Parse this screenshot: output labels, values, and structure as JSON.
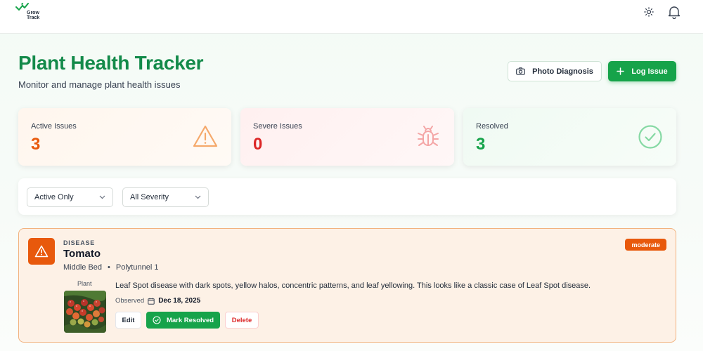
{
  "brand": {
    "logo_text_1": "Grow",
    "logo_text_2": "Track"
  },
  "header": {
    "theme_icon": "sun-icon",
    "notifications_icon": "bell-icon"
  },
  "page": {
    "title": "Plant Health Tracker",
    "subtitle": "Monitor and manage plant health issues",
    "photo_button": "Photo Diagnosis",
    "log_button": "Log Issue"
  },
  "stats": [
    {
      "label": "Active Issues",
      "value": "3",
      "icon": "warning-triangle-icon",
      "color": "#e8590c"
    },
    {
      "label": "Severe Issues",
      "value": "0",
      "icon": "bug-icon",
      "color": "#dc2626"
    },
    {
      "label": "Resolved",
      "value": "3",
      "icon": "check-circle-icon",
      "color": "#16a34a"
    }
  ],
  "filters": {
    "status": "Active Only",
    "severity": "All Severity"
  },
  "issue": {
    "category": "DISEASE",
    "plant": "Tomato",
    "bed": "Middle Bed",
    "separator": "•",
    "location": "Polytunnel 1",
    "severity": "moderate",
    "image_label": "Plant",
    "description": "Leaf Spot disease with dark spots, yellow halos, concentric patterns, and leaf yellowing. This looks like a classic case of Leaf Spot disease.",
    "observed_label": "Observed",
    "observed_date": "Dec 18, 2025",
    "edit": "Edit",
    "resolve": "Mark Resolved",
    "delete": "Delete"
  }
}
